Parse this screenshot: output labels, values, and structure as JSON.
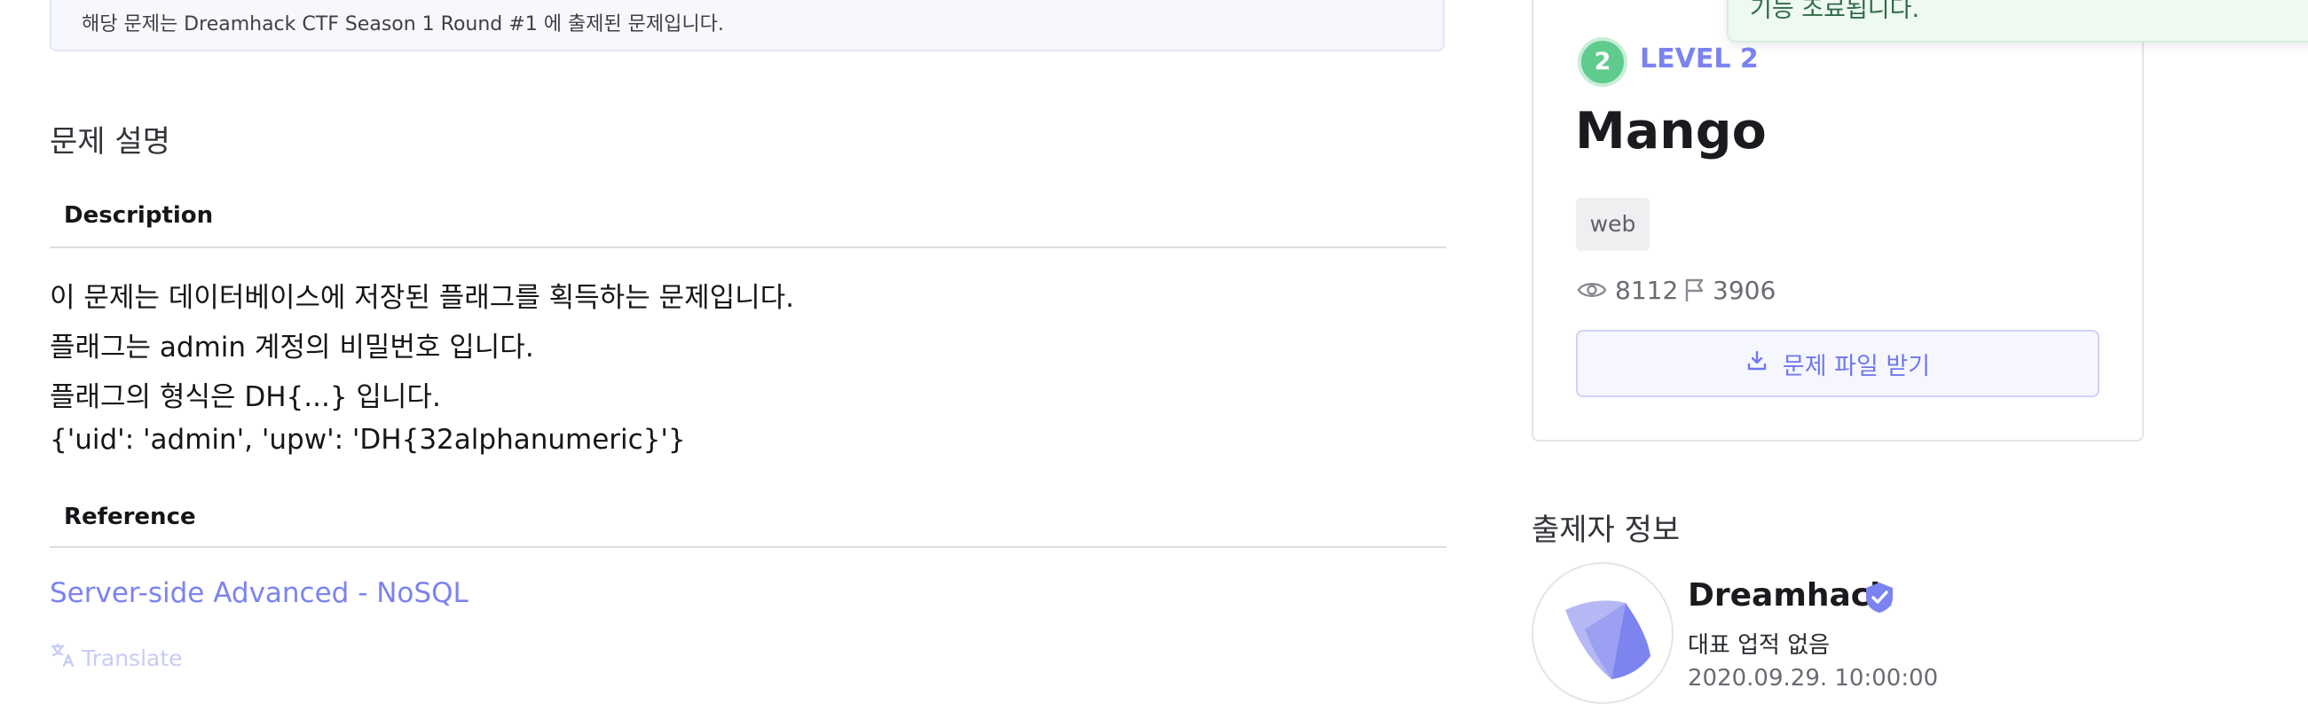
{
  "notice": {
    "text": "해당 문제는 Dreamhack CTF Season 1 Round #1 에 출제된 문제입니다."
  },
  "main": {
    "section_title": "문제 설명",
    "description_heading": "Description",
    "description_lines": [
      "이 문제는 데이터베이스에 저장된 플래그를 획득하는 문제입니다.",
      "플래그는 admin 계정의 비밀번호 입니다.",
      "플래그의 형식은 DH{...} 입니다.",
      "{'uid': 'admin', 'upw': 'DH{32alphanumeric}'}"
    ],
    "reference_heading": "Reference",
    "reference_link": "Server-side Advanced - NoSQL",
    "translate_label": "Translate"
  },
  "toast": {
    "text": "기능 조료됩니다."
  },
  "challenge": {
    "level_number": "2",
    "level_label": "LEVEL 2",
    "title": "Mango",
    "tags": [
      "web"
    ],
    "views": "8112",
    "solves": "3906",
    "download_label": "문제 파일 받기"
  },
  "author": {
    "heading": "출제자 정보",
    "name": "Dreamhack",
    "achievement": "대표 업적 없음",
    "date": "2020.09.29. 10:00:00"
  },
  "colors": {
    "accent": "#7b83f0",
    "level_badge": "#5fcb8d",
    "tag_bg": "#efeff2",
    "notice_bg": "#f7f8fe"
  },
  "icons": {
    "views": "eye-icon",
    "solves": "flag-icon",
    "download": "download-icon",
    "translate": "translate-icon",
    "verified": "verified-badge-icon",
    "avatar": "dreamhack-logo"
  }
}
